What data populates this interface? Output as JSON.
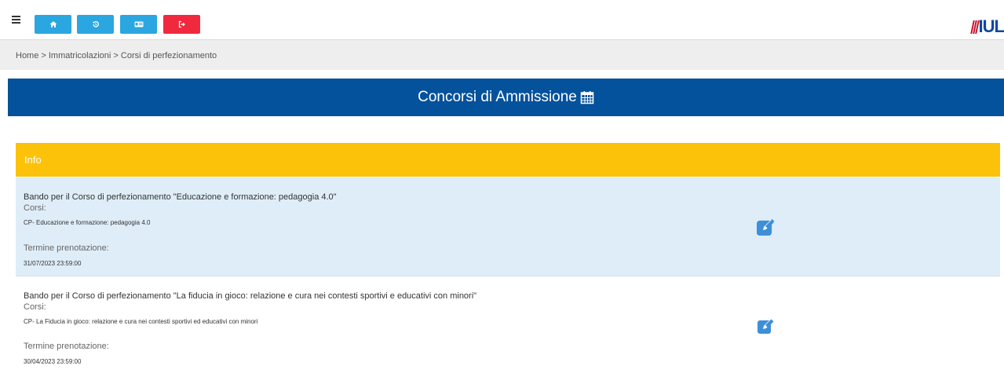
{
  "navbar": {
    "buttons": [
      {
        "name": "home",
        "icon": "home-icon",
        "color": "#2aa6e0"
      },
      {
        "name": "history",
        "icon": "history-icon",
        "color": "#2aa6e0"
      },
      {
        "name": "card",
        "icon": "id-card-icon",
        "color": "#2aa6e0"
      },
      {
        "name": "logout",
        "icon": "logout-icon",
        "color": "#f0293e"
      }
    ],
    "logo_text": "IUL"
  },
  "breadcrumb": "Home > Immatricolazioni > Corsi di perfezionamento",
  "header": {
    "title": "Concorsi di Ammissione",
    "icon": "calendar-icon",
    "color": "#04529c"
  },
  "info": {
    "label": "Info",
    "color": "#fcc20a"
  },
  "rows": [
    {
      "bando": "Bando per il Corso di perfezionamento \"Educazione e formazione: pedagogia 4.0\"",
      "corsi_label": "Corsi:",
      "corso": "CP- Educazione e formazione: pedagogia 4.0",
      "termine_label": "Termine prenotazione:",
      "termine": "31/07/2023 23:59:00"
    },
    {
      "bando": "Bando per il Corso di perfezionamento \"La fiducia in gioco: relazione e cura nei contesti sportivi e educativi con minori\"",
      "corsi_label": "Corsi:",
      "corso": "CP- La Fiducia in gioco: relazione e cura nei contesti sportivi ed educativi con minori",
      "termine_label": "Termine prenotazione:",
      "termine": "30/04/2023 23:59:00"
    }
  ],
  "accent_blue": "#3e8fd8"
}
